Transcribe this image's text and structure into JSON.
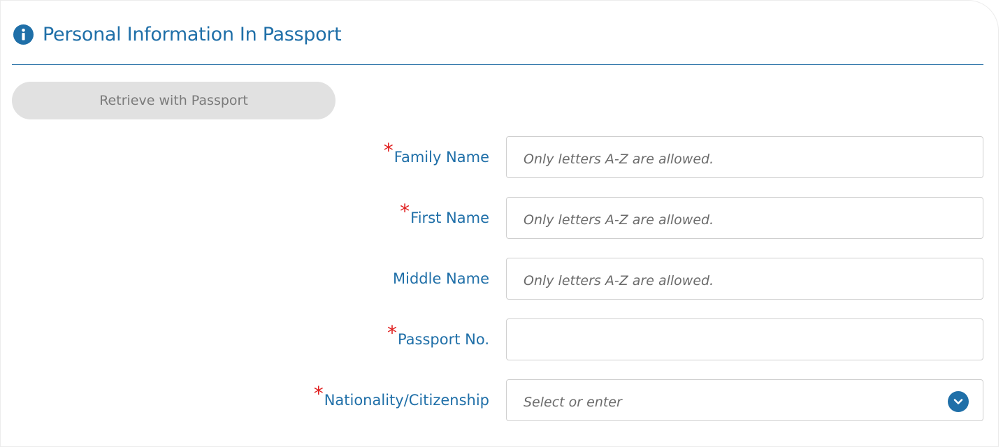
{
  "section": {
    "title": "Personal Information In Passport",
    "icon": "info-icon",
    "accent_color": "#1f6fa8"
  },
  "retrieve_button": {
    "label": "Retrieve with Passport"
  },
  "fields": {
    "family_name": {
      "label": "Family Name",
      "required": true,
      "placeholder": "Only letters A-Z are allowed.",
      "value": ""
    },
    "first_name": {
      "label": "First Name",
      "required": true,
      "placeholder": "Only letters A-Z are allowed.",
      "value": ""
    },
    "middle_name": {
      "label": "Middle Name",
      "required": false,
      "placeholder": "Only letters A-Z are allowed.",
      "value": ""
    },
    "passport_no": {
      "label": "Passport No.",
      "required": true,
      "placeholder": "",
      "value": ""
    },
    "nationality": {
      "label": "Nationality/Citizenship",
      "required": true,
      "placeholder": "Select or enter",
      "icon": "chevron-down-icon"
    }
  },
  "required_marker": "*"
}
